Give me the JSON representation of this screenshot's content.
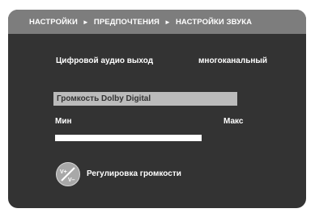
{
  "header": {
    "breadcrumb": [
      "НАСТРОЙКИ",
      "ПРЕДПОЧТЕНИЯ",
      "НАСТРОЙКИ ЗВУКА"
    ],
    "separator": "►"
  },
  "digital_output": {
    "label": "Цифровой аудио выход",
    "value": "многоканальный"
  },
  "volume": {
    "title": "Громкость Dolby Digital",
    "min_label": "Мин",
    "max_label": "Макс",
    "level": 1.0
  },
  "hint": {
    "button_top": "V+",
    "button_bottom": "V–",
    "text": "Регулировка громкости"
  },
  "colors": {
    "screen_bg": "#333333",
    "header_bg": "#7d7d7d",
    "highlight_bg": "#bbbbbb",
    "slider_fill": "#ffffff"
  }
}
